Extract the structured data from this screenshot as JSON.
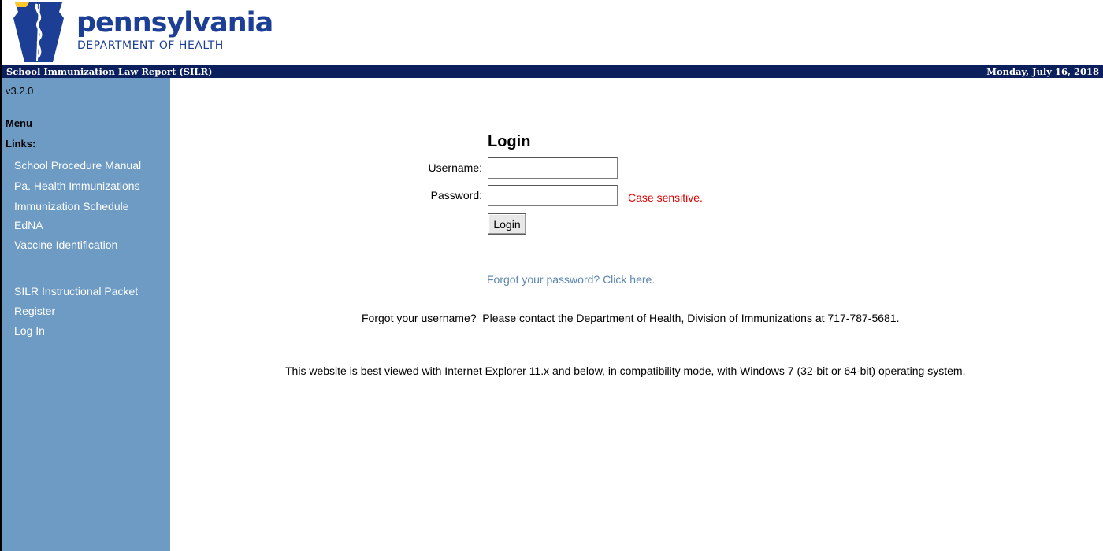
{
  "header": {
    "logo_word": "pennsylvania",
    "logo_subtitle": "DEPARTMENT OF HEALTH",
    "app_title": "School Immunization Law Report (SILR)",
    "date": "Monday, July 16, 2018",
    "brand_color": "#1c3f95",
    "bar_color": "#0b1f5c"
  },
  "sidebar": {
    "version": "v3.2.0",
    "menu_heading": "Menu",
    "links_heading": "Links:",
    "links": [
      "School Procedure Manual",
      "Pa. Health Immunizations",
      "Immunization Schedule",
      "EdNA",
      "Vaccine Identification"
    ],
    "actions": [
      "SILR Instructional Packet",
      "Register",
      "Log In"
    ],
    "background_color": "#6d9bc3"
  },
  "login": {
    "title": "Login",
    "username_label": "Username:",
    "username_value": "",
    "password_label": "Password:",
    "password_value": "",
    "case_note": "Case sensitive.",
    "button_label": "Login",
    "forgot_password": "Forgot your password? Click here.",
    "forgot_username": "Forgot your username?  Please contact the Department of Health, Division of Immunizations at 717-787-5681.",
    "browser_note": "This website is best viewed with Internet Explorer 11.x and below, in compatibility mode, with Windows 7 (32-bit or 64-bit) operating system."
  }
}
